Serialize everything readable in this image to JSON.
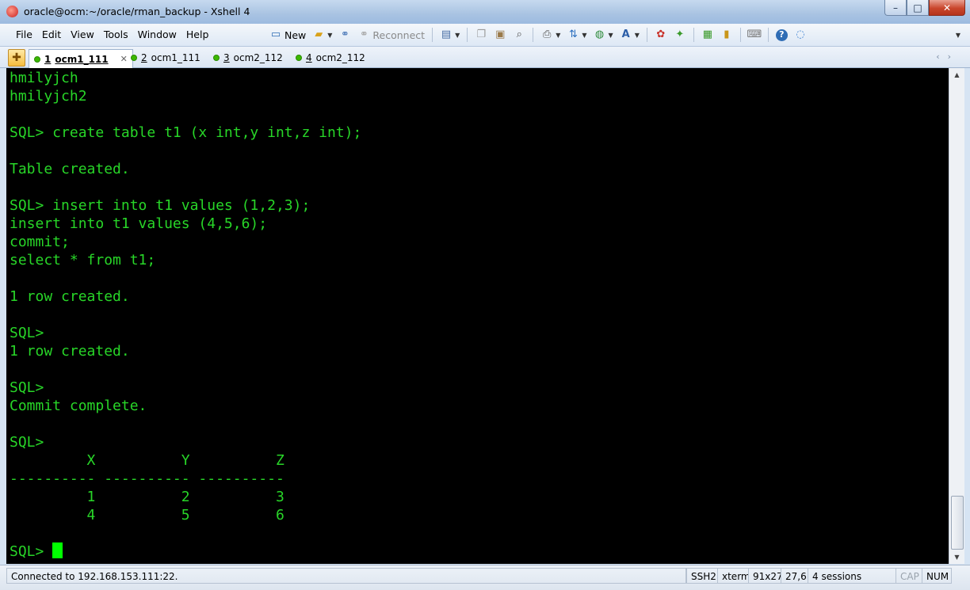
{
  "window": {
    "title": "oracle@ocm:~/oracle/rman_backup - Xshell 4",
    "controls": {
      "minimize": "–",
      "maximize": "□",
      "close": "✕"
    }
  },
  "menu": [
    "File",
    "Edit",
    "View",
    "Tools",
    "Window",
    "Help"
  ],
  "toolbar": {
    "new_label": "New",
    "reconnect_label": "Reconnect"
  },
  "tabs": [
    {
      "num": "1",
      "label": "ocm1_111",
      "active": true
    },
    {
      "num": "2",
      "label": "ocm1_111",
      "active": false
    },
    {
      "num": "3",
      "label": "ocm2_112",
      "active": false
    },
    {
      "num": "4",
      "label": "ocm2_112",
      "active": false
    }
  ],
  "terminal": {
    "text_color": "#28d628",
    "lines": [
      "hmilyjch",
      "hmilyjch2",
      "",
      "SQL> create table t1 (x int,y int,z int);",
      "",
      "Table created.",
      "",
      "SQL> insert into t1 values (1,2,3);",
      "insert into t1 values (4,5,6);",
      "commit;",
      "select * from t1;",
      "",
      "1 row created.",
      "",
      "SQL>",
      "1 row created.",
      "",
      "SQL>",
      "Commit complete.",
      "",
      "SQL>",
      "         X          Y          Z",
      "---------- ---------- ----------",
      "         1          2          3",
      "         4          5          6",
      "",
      "SQL> "
    ]
  },
  "status": {
    "connection": "Connected to 192.168.153.111:22.",
    "protocol": "SSH2",
    "term": "xterm",
    "size": "91x27",
    "cursor_pos": "27,6",
    "sessions": "4 sessions",
    "cap": "CAP",
    "num": "NUM"
  }
}
